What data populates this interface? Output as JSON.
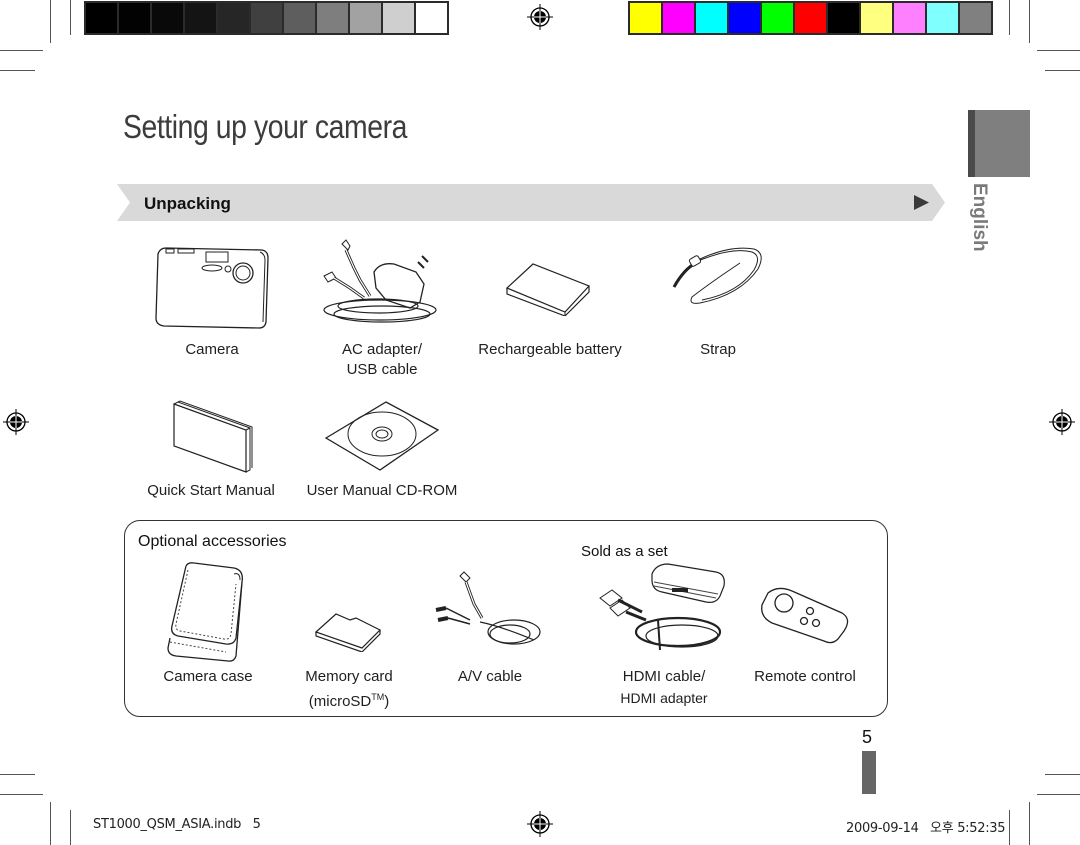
{
  "color_bar_gray": [
    "#000000",
    "#020202",
    "#090909",
    "#141414",
    "#262626",
    "#404040",
    "#5e5e5e",
    "#7e7e7e",
    "#a2a2a2",
    "#cfcfcf",
    "#ffffff"
  ],
  "color_bar_color": [
    "#ffff00",
    "#ff00ff",
    "#00ffff",
    "#0000ff",
    "#00ff00",
    "#ff0000",
    "#000000",
    "#ffff80",
    "#ff80ff",
    "#80ffff",
    "#808080"
  ],
  "page": {
    "title": "Setting up your camera",
    "language_tab": "English",
    "page_number": "5"
  },
  "unpacking": {
    "heading": "Unpacking",
    "items": [
      {
        "line1": "Camera",
        "line2": "",
        "icon": "camera-icon"
      },
      {
        "line1": "AC adapter/",
        "line2": "USB cable",
        "icon": "ac-adapter-icon"
      },
      {
        "line1": "Rechargeable battery",
        "line2": "",
        "icon": "battery-icon"
      },
      {
        "line1": "Strap",
        "line2": "",
        "icon": "strap-icon"
      },
      {
        "line1": "Quick Start Manual",
        "line2": "",
        "icon": "manual-icon"
      },
      {
        "line1": "User Manual CD-ROM",
        "line2": "",
        "icon": "cd-rom-icon"
      }
    ]
  },
  "optional": {
    "heading": "Optional accessories",
    "set_label": "Sold as a set",
    "items": [
      {
        "line1": "Camera case",
        "line2": "",
        "icon": "camera-case-icon"
      },
      {
        "line1": "Memory card",
        "line2": "(microSD",
        "line2_sup": "TM",
        "line2_end": ")",
        "icon": "memory-card-icon"
      },
      {
        "line1": "A/V cable",
        "line2": "",
        "icon": "av-cable-icon"
      },
      {
        "line1": "HDMI cable/",
        "line2": "HDMI adapter",
        "icon": "hdmi-cable-icon"
      },
      {
        "line1": "Remote control",
        "line2": "",
        "icon": "remote-control-icon"
      }
    ]
  },
  "footer": {
    "file": "ST1000_QSM_ASIA.indb   5",
    "timestamp": "2009-09-14   오후 5:52:35"
  }
}
